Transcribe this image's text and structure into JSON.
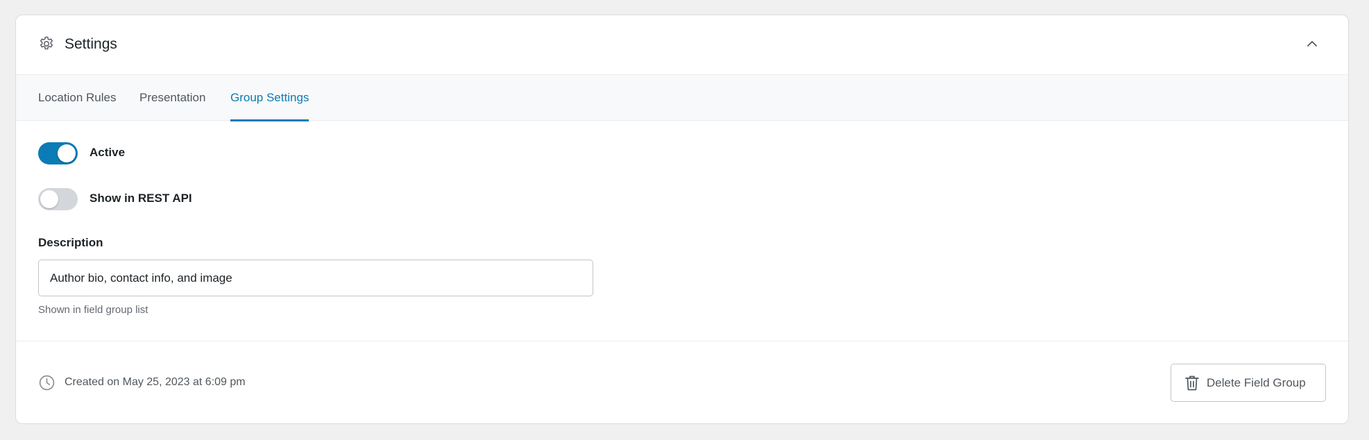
{
  "panel": {
    "title": "Settings",
    "header_icon": "gear-icon",
    "collapse_icon": "chevron-up-icon"
  },
  "tabs": [
    {
      "label": "Location Rules",
      "active": false
    },
    {
      "label": "Presentation",
      "active": false
    },
    {
      "label": "Group Settings",
      "active": true
    }
  ],
  "settings": {
    "active": {
      "label": "Active",
      "checked": true
    },
    "rest_api": {
      "label": "Show in REST API",
      "checked": false
    },
    "description": {
      "label": "Description",
      "value": "Author bio, contact info, and image",
      "hint": "Shown in field group list"
    }
  },
  "footer": {
    "created_icon": "clock-icon",
    "created_text": "Created on May 25, 2023 at 6:09 pm",
    "delete_icon": "trash-icon",
    "delete_label": "Delete Field Group"
  },
  "colors": {
    "accent": "#0a7bb5",
    "toggle_off": "#d3d6db",
    "muted_text": "#50575e"
  }
}
